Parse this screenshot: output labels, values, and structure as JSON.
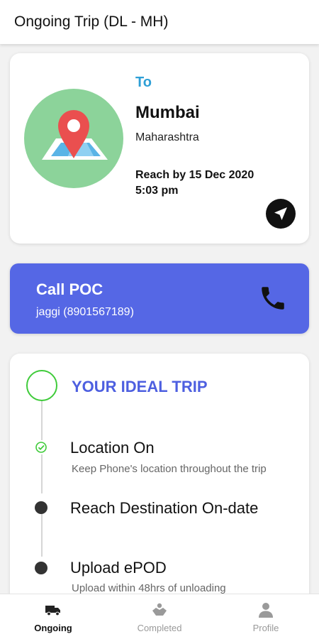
{
  "header": {
    "title": "Ongoing Trip (DL - MH)"
  },
  "destination": {
    "to_label": "To",
    "city": "Mumbai",
    "state": "Maharashtra",
    "reach_by": "Reach by 15 Dec 2020\n 5:03 pm"
  },
  "call": {
    "title": "Call POC",
    "contact": "jaggi (8901567189)"
  },
  "trip": {
    "title": "YOUR IDEAL TRIP",
    "steps": [
      {
        "title": "Location On",
        "subtitle": "Keep Phone's location throughout the trip"
      },
      {
        "title": "Reach Destination On-date",
        "subtitle": ""
      },
      {
        "title": "Upload ePOD",
        "subtitle": "Upload within 48hrs of unloading"
      }
    ]
  },
  "bottom_nav": [
    {
      "label": "Ongoing",
      "icon": "truck-icon"
    },
    {
      "label": "Completed",
      "icon": "handshake-icon"
    },
    {
      "label": "Profile",
      "icon": "person-icon"
    }
  ],
  "colors": {
    "accent_blue": "#5567e5",
    "link_blue": "#2e9fd6",
    "success_green": "#3fcb3a",
    "map_green": "#8cd39a"
  }
}
